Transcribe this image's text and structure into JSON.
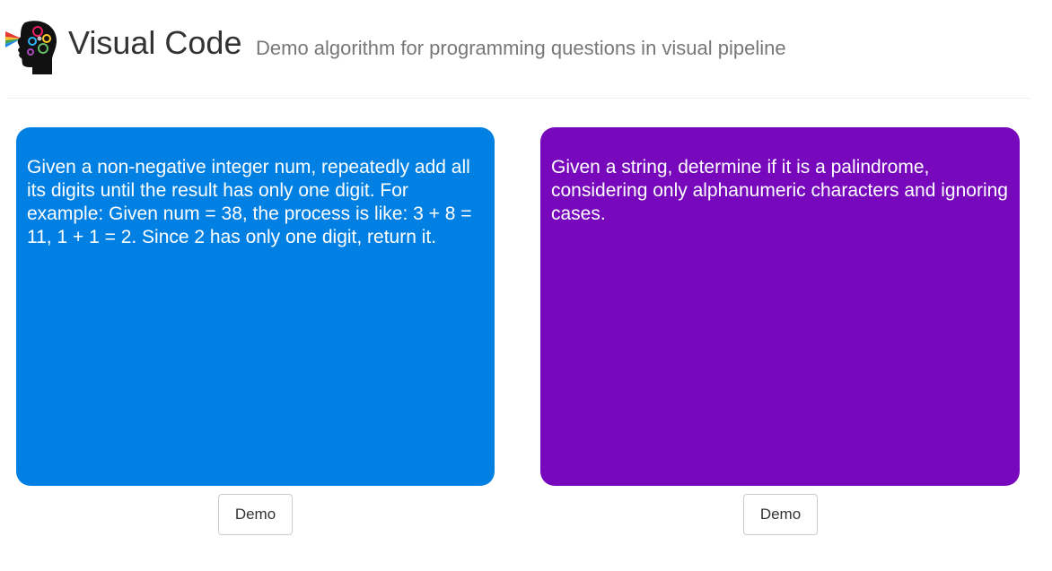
{
  "header": {
    "title": "Visual Code",
    "subtitle": "Demo algorithm for programming questions in visual pipeline",
    "logo_icon": "brain-head-logo-icon"
  },
  "cards": [
    {
      "text": "Given a non-negative integer num, repeatedly add all its digits until the result has only one digit. For example: Given num = 38, the process is like: 3 + 8 = 11, 1 + 1 = 2. Since 2 has only one digit, return it.",
      "color": "#0180e3",
      "button_label": "Demo"
    },
    {
      "text": "Given a string, determine if it is a palindrome, considering only alphanumeric characters and ignoring cases.",
      "color": "#7808bc",
      "button_label": "Demo"
    }
  ]
}
